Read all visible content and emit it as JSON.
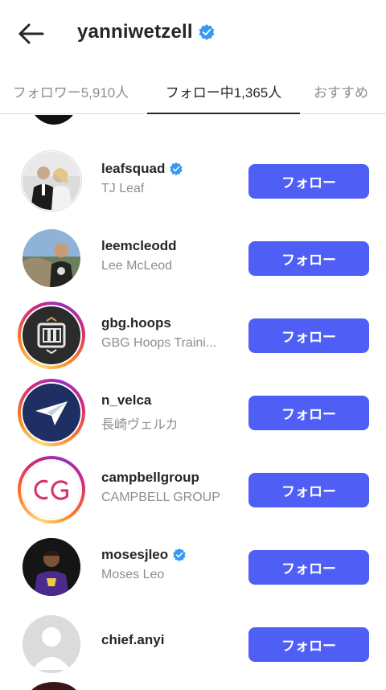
{
  "header": {
    "title": "yanniwetzell",
    "back_icon": "arrow-left-icon",
    "verified_icon": "verified-badge-icon"
  },
  "tabs": [
    {
      "label": "フォロワー5,910人",
      "active": false
    },
    {
      "label": "フォロー中1,365人",
      "active": true
    },
    {
      "label": "おすすめ",
      "active": false
    }
  ],
  "colors": {
    "accent": "#4f5ef4",
    "verified": "#3897f0",
    "primary_text": "#262626",
    "secondary_text": "#8e8e8e"
  },
  "follow_label": "フォロー",
  "users": [
    {
      "username": "leafsquad",
      "fullname": "TJ Leaf",
      "verified": true,
      "story": false
    },
    {
      "username": "leemcleodd",
      "fullname": "Lee McLeod",
      "verified": false,
      "story": false
    },
    {
      "username": "gbg.hoops",
      "fullname": "GBG Hoops Traini...",
      "verified": false,
      "story": true
    },
    {
      "username": "n_velca",
      "fullname": "長崎ヴェルカ",
      "verified": false,
      "story": true
    },
    {
      "username": "campbellgroup",
      "fullname": "CAMPBELL GROUP",
      "verified": false,
      "story": true
    },
    {
      "username": "mosesjleo",
      "fullname": "Moses Leo",
      "verified": true,
      "story": false
    },
    {
      "username": "chief.anyi",
      "fullname": "",
      "verified": false,
      "story": false
    }
  ]
}
